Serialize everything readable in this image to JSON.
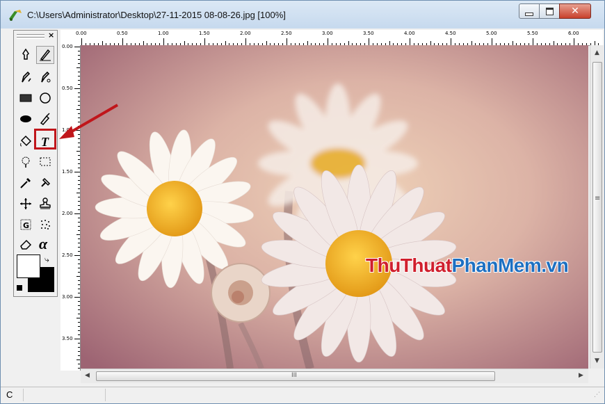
{
  "window": {
    "title": "C:\\Users\\Administrator\\Desktop\\27-11-2015 08-08-26.jpg [100%]",
    "icon": "paint-palette-icon",
    "buttons": {
      "minimize": "minimize-icon",
      "maximize": "maximize-icon",
      "close": "✕"
    }
  },
  "toolbox": {
    "close_label": "×",
    "tools": [
      {
        "name": "free-form-select-icon",
        "glyph": "♠"
      },
      {
        "name": "pencil-icon",
        "glyph": "✎"
      },
      {
        "name": "brush-icon",
        "glyph": "✐"
      },
      {
        "name": "airbrush-icon",
        "glyph": "✐"
      },
      {
        "name": "rectangle-icon",
        "glyph": "▬"
      },
      {
        "name": "ellipse-icon",
        "glyph": "○"
      },
      {
        "name": "filled-ellipse-icon",
        "glyph": "●"
      },
      {
        "name": "pen-icon",
        "glyph": "✑"
      },
      {
        "name": "fill-bucket-icon",
        "glyph": "◈"
      },
      {
        "name": "text-tool-icon",
        "glyph": "T"
      },
      {
        "name": "magic-wand-icon",
        "glyph": "◉"
      },
      {
        "name": "rect-select-icon",
        "glyph": "⬚"
      },
      {
        "name": "eyedropper-icon",
        "glyph": "⟋"
      },
      {
        "name": "hammer-icon",
        "glyph": "⚒"
      },
      {
        "name": "move-icon",
        "glyph": "✥"
      },
      {
        "name": "stamp-icon",
        "glyph": "♣"
      },
      {
        "name": "g-icon",
        "glyph": "G"
      },
      {
        "name": "scatter-icon",
        "glyph": "⁘"
      },
      {
        "name": "eraser-icon",
        "glyph": "◇"
      },
      {
        "name": "alpha-icon",
        "glyph": "α"
      }
    ],
    "colors": {
      "foreground": "#ffffff",
      "background": "#000000"
    }
  },
  "rulers": {
    "horizontal": [
      "0.00",
      "0.50",
      "1.00",
      "1.50",
      "2.00",
      "2.50",
      "3.00",
      "3.50",
      "4.00",
      "4.50",
      "5.00",
      "5.50",
      "6.00"
    ],
    "vertical": [
      "0.00",
      "0.50",
      "1.00",
      "1.50",
      "2.00",
      "2.50",
      "3.00",
      "3.50"
    ]
  },
  "canvas": {
    "watermark_red": "ThuThuat",
    "watermark_blue": "PhanMem",
    "watermark_suffix": ".vn",
    "highlight_color": "#c0161b"
  },
  "scrollbars": {
    "v_mid": "≡",
    "h_mid": "III"
  },
  "status": {
    "cell1": "C",
    "cell2": "",
    "cell3": ""
  }
}
